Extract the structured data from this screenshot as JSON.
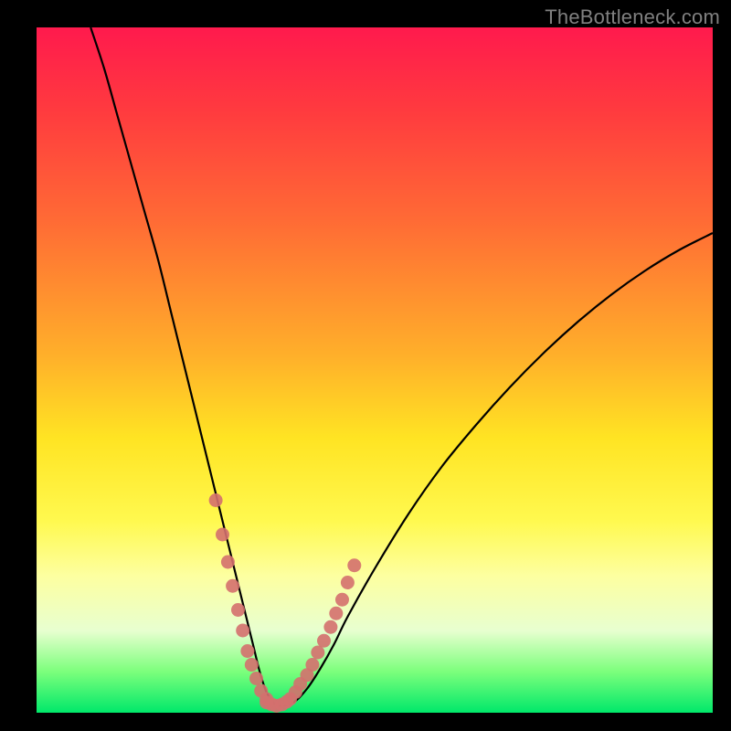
{
  "watermark": "TheBottleneck.com",
  "colors": {
    "background": "#000000",
    "gradient_top": "#ff1a4d",
    "gradient_bottom": "#00e86a",
    "curve": "#000000",
    "dots": "#d4706e"
  },
  "chart_data": {
    "type": "line",
    "title": "",
    "xlabel": "",
    "ylabel": "",
    "xlim": [
      0,
      100
    ],
    "ylim": [
      0,
      100
    ],
    "series": [
      {
        "name": "bottleneck-curve",
        "x": [
          8,
          10,
          12,
          14,
          16,
          18,
          20,
          22,
          24,
          26,
          28,
          30,
          32,
          33,
          34,
          35,
          36,
          38,
          40,
          42,
          44,
          46,
          50,
          55,
          60,
          65,
          70,
          75,
          80,
          85,
          90,
          95,
          100
        ],
        "y": [
          100,
          94,
          87,
          80,
          73,
          66,
          58,
          50,
          42,
          34,
          26,
          18,
          10,
          6,
          3,
          1.5,
          1,
          1.5,
          3.5,
          6.5,
          10,
          14,
          21,
          29,
          36,
          42,
          47.5,
          52.5,
          57,
          61,
          64.5,
          67.5,
          70
        ]
      }
    ],
    "markers": [
      {
        "name": "highlight-dots-left",
        "x": [
          26.5,
          27.5,
          28.3,
          29.0,
          29.8,
          30.5,
          31.2,
          31.8,
          32.5,
          33.2,
          34.0
        ],
        "y": [
          31.0,
          26.0,
          22.0,
          18.5,
          15.0,
          12.0,
          9.0,
          7.0,
          5.0,
          3.2,
          2.0
        ]
      },
      {
        "name": "highlight-dots-right",
        "x": [
          37.5,
          38.3,
          39.0,
          40.0,
          40.8,
          41.6,
          42.5,
          43.5,
          44.3,
          45.2,
          46.0,
          47.0
        ],
        "y": [
          2.0,
          3.0,
          4.2,
          5.5,
          7.0,
          8.8,
          10.5,
          12.5,
          14.5,
          16.5,
          19.0,
          21.5
        ]
      },
      {
        "name": "highlight-dots-bottom",
        "x": [
          34.0,
          34.8,
          35.5,
          36.3,
          37.0
        ],
        "y": [
          1.5,
          1.2,
          1.0,
          1.2,
          1.6
        ]
      }
    ]
  }
}
